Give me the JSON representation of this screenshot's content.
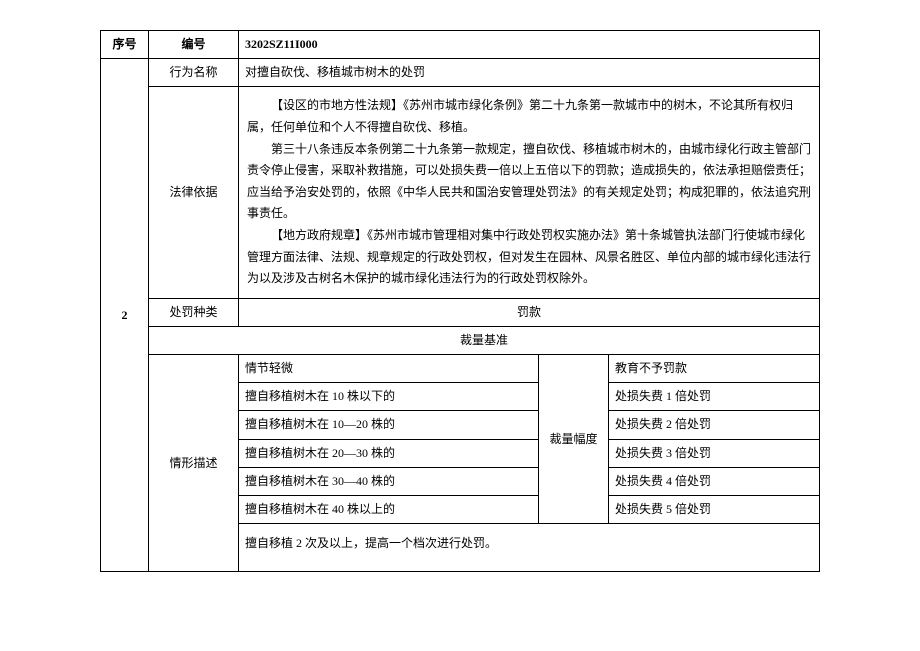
{
  "header": {
    "seq_label": "序号",
    "code_label": "编号",
    "code_value": "3202SZ11I000"
  },
  "row": {
    "seq": "2",
    "behavior_name_label": "行为名称",
    "behavior_name_value": "对擅自砍伐、移植城市树木的处罚",
    "law_basis_label": "法律依据",
    "law_basis_text": "　　【设区的市地方性法规】《苏州市城市绿化条例》第二十九条第一款城市中的树木，不论其所有权归属，任何单位和个人不得擅自砍伐、移植。\n　　第三十八条违反本条例第二十九条第一款规定，擅自砍伐、移植城市树木的，由城市绿化行政主管部门责令停止侵害，采取补救措施，可以处损失费一倍以上五倍以下的罚款；造成损失的，依法承担赔偿责任；应当给予治安处罚的，依照《中华人民共和国治安管理处罚法》的有关规定处罚；构成犯罪的，依法追究刑事责任。\n　　【地方政府规章】《苏州市城市管理相对集中行政处罚权实施办法》第十条城管执法部门行使城市绿化管理方面法律、法规、规章规定的行政处罚权，但对发生在园林、风景名胜区、单位内部的城市绿化违法行为以及涉及古树名木保护的城市绿化违法行为的行政处罚权除外。",
    "penalty_type_label": "处罚种类",
    "penalty_type_value": "罚款",
    "discretion_basis_label": "裁量基准",
    "situation_label": "情形描述",
    "amplitude_label": "裁量幅度",
    "tiers": [
      {
        "situation": "情节轻微",
        "amplitude": "教育不予罚款"
      },
      {
        "situation": "擅自移植树木在 10 株以下的",
        "amplitude": "处损失费 1 倍处罚"
      },
      {
        "situation": "擅自移植树木在 10—20 株的",
        "amplitude": "处损失费 2 倍处罚"
      },
      {
        "situation": "擅自移植树木在 20—30 株的",
        "amplitude": "处损失费 3 倍处罚"
      },
      {
        "situation": "擅自移植树木在 30—40 株的",
        "amplitude": "处损失费 4 倍处罚"
      },
      {
        "situation": "擅自移植树木在 40 株以上的",
        "amplitude": "处损失费 5 倍处罚"
      }
    ],
    "note": "擅自移植 2 次及以上，提高一个档次进行处罚。"
  }
}
